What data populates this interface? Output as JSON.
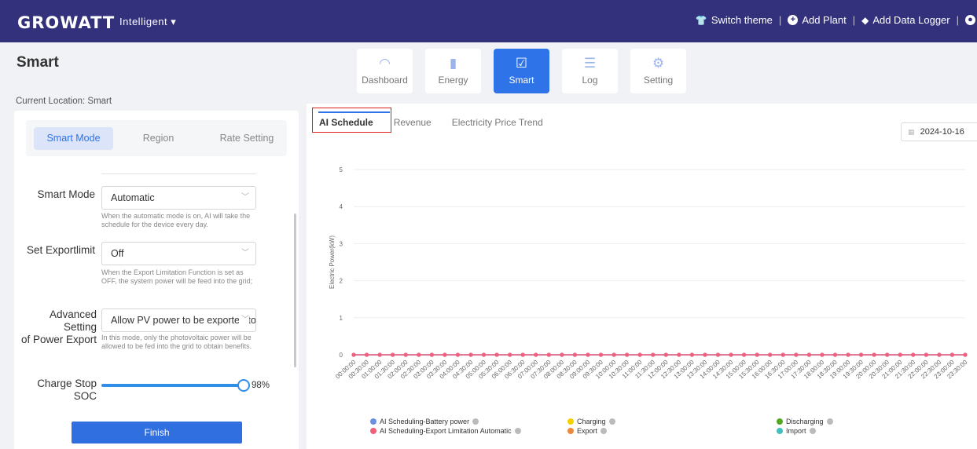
{
  "header": {
    "logo": "GROWATT",
    "mode": "Intelligent ▾",
    "nav": [
      {
        "label": "Switch theme",
        "icon": "shirt-icon"
      },
      {
        "label": "Add Plant",
        "icon": "plus-circle-icon"
      },
      {
        "label": "Add Data Logger",
        "icon": "pen-icon"
      }
    ],
    "separator": "|"
  },
  "page": {
    "title": "Smart",
    "location": "Current Location: Smart"
  },
  "navtabs": [
    {
      "label": "Dashboard",
      "icon": "gauge-icon",
      "glyph": "◜◝"
    },
    {
      "label": "Energy",
      "icon": "bar-chart-icon",
      "glyph": "▂▅▃"
    },
    {
      "label": "Smart",
      "icon": "calendar-check-icon",
      "glyph": "☑",
      "active": true
    },
    {
      "label": "Log",
      "icon": "log-list-icon",
      "glyph": "☰"
    },
    {
      "label": "Setting",
      "icon": "gear-icon",
      "glyph": "⚙"
    }
  ],
  "left": {
    "subtabs": [
      "Smart Mode",
      "Region",
      "Rate Setting"
    ],
    "fields": {
      "smart_mode": {
        "label": "Smart Mode",
        "value": "Automatic",
        "hint": "When the automatic mode is on, AI will take the schedule for the device every day."
      },
      "export_limit": {
        "label": "Set Exportlimit",
        "value": "Off",
        "hint": "When the Export Limitation Function is set as OFF, the system power will be feed into the grid;"
      },
      "advanced": {
        "label_line1": "Advanced Setting",
        "label_line2": "of Power Export",
        "value": "Allow PV power to be exported to",
        "hint": "In this mode, only the photovoltaic power will be allowed to be fed into the grid to obtain benefits."
      },
      "charge_stop": {
        "label": "Charge Stop SOC",
        "value": 98,
        "display": "98%"
      }
    },
    "finish_label": "Finish"
  },
  "right": {
    "tabs": [
      "AI Schedule",
      "Revenue",
      "Electricity Price Trend"
    ],
    "date": "2024-10-16"
  },
  "chart_data": {
    "type": "line",
    "ylabel": "Electric Power(kW)",
    "ylim": [
      0,
      5
    ],
    "yticks": [
      0,
      1,
      2,
      3,
      4,
      5
    ],
    "x": [
      "00:00:00",
      "00:30:00",
      "01:00:00",
      "01:30:00",
      "02:00:00",
      "02:30:00",
      "03:00:00",
      "03:30:00",
      "04:00:00",
      "04:30:00",
      "05:00:00",
      "05:30:00",
      "06:00:00",
      "06:30:00",
      "07:00:00",
      "07:30:00",
      "08:00:00",
      "08:30:00",
      "09:00:00",
      "09:30:00",
      "10:00:00",
      "10:30:00",
      "11:00:00",
      "11:30:00",
      "12:00:00",
      "12:30:00",
      "13:00:00",
      "13:30:00",
      "14:00:00",
      "14:30:00",
      "15:00:00",
      "15:30:00",
      "16:00:00",
      "16:30:00",
      "17:00:00",
      "17:30:00",
      "18:00:00",
      "18:30:00",
      "19:00:00",
      "19:30:00",
      "20:00:00",
      "20:30:00",
      "21:00:00",
      "21:30:00",
      "22:00:00",
      "22:30:00",
      "23:00:00",
      "23:30:00"
    ],
    "series": [
      {
        "name": "AI Scheduling-Battery power",
        "color": "#6b8fe0",
        "values": [
          0,
          0,
          0,
          0,
          0,
          0,
          0,
          0,
          0,
          0,
          0,
          0,
          0,
          0,
          0,
          0,
          0,
          0,
          0,
          0,
          0,
          0,
          0,
          0,
          0,
          0,
          0,
          0,
          0,
          0,
          0,
          0,
          0,
          0,
          0,
          0,
          0,
          0,
          0,
          0,
          0,
          0,
          0,
          0,
          0,
          0,
          0,
          0
        ]
      },
      {
        "name": "AI Scheduling-Export Limitation Automatic",
        "color": "#f0607a",
        "values": [
          0,
          0,
          0,
          0,
          0,
          0,
          0,
          0,
          0,
          0,
          0,
          0,
          0,
          0,
          0,
          0,
          0,
          0,
          0,
          0,
          0,
          0,
          0,
          0,
          0,
          0,
          0,
          0,
          0,
          0,
          0,
          0,
          0,
          0,
          0,
          0,
          0,
          0,
          0,
          0,
          0,
          0,
          0,
          0,
          0,
          0,
          0,
          0
        ]
      },
      {
        "name": "Charging",
        "color": "#f5d000",
        "values": []
      },
      {
        "name": "Export",
        "color": "#f0883a",
        "values": []
      },
      {
        "name": "Discharging",
        "color": "#52a820",
        "values": []
      },
      {
        "name": "Import",
        "color": "#40c0c0",
        "values": []
      }
    ]
  }
}
